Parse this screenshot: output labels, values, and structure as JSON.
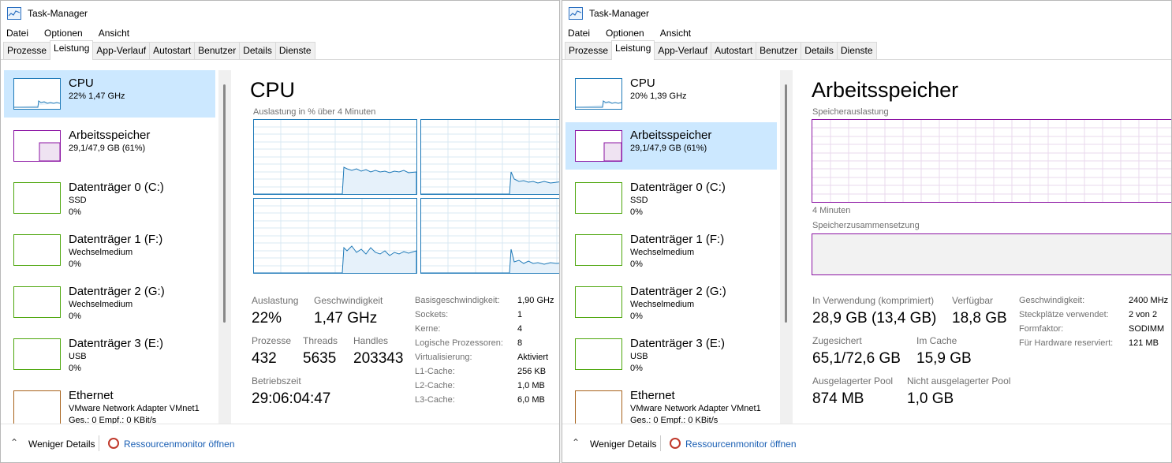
{
  "colors": {
    "cpu": "#1f7ab8",
    "memory": "#8b13a3",
    "disk": "#4da60c",
    "ethernet": "#a7621b",
    "selected": "#cce8ff"
  },
  "left": {
    "title": "Task-Manager",
    "menu": [
      "Datei",
      "Optionen",
      "Ansicht"
    ],
    "tabs": [
      "Prozesse",
      "Leistung",
      "App-Verlauf",
      "Autostart",
      "Benutzer",
      "Details",
      "Dienste"
    ],
    "sidebar": [
      {
        "name": "CPU",
        "line1": "22%  1,47 GHz",
        "line2": ""
      },
      {
        "name": "Arbeitsspeicher",
        "line1": "29,1/47,9 GB (61%)",
        "line2": ""
      },
      {
        "name": "Datenträger 0 (C:)",
        "line1": "SSD",
        "line2": "0%"
      },
      {
        "name": "Datenträger 1 (F:)",
        "line1": "Wechselmedium",
        "line2": "0%"
      },
      {
        "name": "Datenträger 2 (G:)",
        "line1": "Wechselmedium",
        "line2": "0%"
      },
      {
        "name": "Datenträger 3 (E:)",
        "line1": "USB",
        "line2": "0%"
      },
      {
        "name": "Ethernet",
        "line1": "VMware Network Adapter VMnet1",
        "line2": "Ges.: 0 Empf.: 0 KBit/s"
      }
    ],
    "main": {
      "title": "CPU",
      "graph_label": "Auslastung in % über 4 Minuten",
      "stats": {
        "auslastung_label": "Auslastung",
        "auslastung": "22%",
        "geschw_label": "Geschwindigkeit",
        "geschw": "1,47 GHz",
        "prozesse_label": "Prozesse",
        "prozesse": "432",
        "threads_label": "Threads",
        "threads": "5635",
        "handles_label": "Handles",
        "handles": "203343",
        "betrieb_label": "Betriebszeit",
        "betrieb": "29:06:04:47"
      },
      "details": [
        {
          "k": "Basisgeschwindigkeit:",
          "v": "1,90 GHz"
        },
        {
          "k": "Sockets:",
          "v": "1"
        },
        {
          "k": "Kerne:",
          "v": "4"
        },
        {
          "k": "Logische Prozessoren:",
          "v": "8"
        },
        {
          "k": "Virtualisierung:",
          "v": "Aktiviert"
        },
        {
          "k": "L1-Cache:",
          "v": "256 KB"
        },
        {
          "k": "L2-Cache:",
          "v": "1,0 MB"
        },
        {
          "k": "L3-Cache:",
          "v": "6,0 MB"
        }
      ]
    },
    "footer": {
      "less": "Weniger Details",
      "monitor": "Ressourcenmonitor öffnen"
    }
  },
  "right": {
    "title": "Task-Manager",
    "menu": [
      "Datei",
      "Optionen",
      "Ansicht"
    ],
    "tabs": [
      "Prozesse",
      "Leistung",
      "App-Verlauf",
      "Autostart",
      "Benutzer",
      "Details",
      "Dienste"
    ],
    "sidebar": [
      {
        "name": "CPU",
        "line1": "20%  1,39 GHz",
        "line2": ""
      },
      {
        "name": "Arbeitsspeicher",
        "line1": "29,1/47,9 GB (61%)",
        "line2": ""
      },
      {
        "name": "Datenträger 0 (C:)",
        "line1": "SSD",
        "line2": "0%"
      },
      {
        "name": "Datenträger 1 (F:)",
        "line1": "Wechselmedium",
        "line2": "0%"
      },
      {
        "name": "Datenträger 2 (G:)",
        "line1": "Wechselmedium",
        "line2": "0%"
      },
      {
        "name": "Datenträger 3 (E:)",
        "line1": "USB",
        "line2": "0%"
      },
      {
        "name": "Ethernet",
        "line1": "VMware Network Adapter VMnet1",
        "line2": "Ges.: 0 Empf.: 0 KBit/s"
      }
    ],
    "main": {
      "title": "Arbeitsspeicher",
      "usage_label": "Speicherauslastung",
      "time_label": "4 Minuten",
      "comp_label": "Speicherzusammensetzung",
      "stats": {
        "inuse_label": "In Verwendung (komprimiert)",
        "inuse": "28,9 GB (13,4 GB)",
        "avail_label": "Verfügbar",
        "avail": "18,8 GB",
        "commit_label": "Zugesichert",
        "commit": "65,1/72,6 GB",
        "cache_label": "Im Cache",
        "cache": "15,9 GB",
        "paged_label": "Ausgelagerter Pool",
        "paged": "874 MB",
        "nonpaged_label": "Nicht ausgelagerter Pool",
        "nonpaged": "1,0 GB"
      },
      "details": [
        {
          "k": "Geschwindigkeit:",
          "v": "2400 MHz"
        },
        {
          "k": "Steckplätze verwendet:",
          "v": "2 von 2"
        },
        {
          "k": "Formfaktor:",
          "v": "SODIMM"
        },
        {
          "k": "Für Hardware reserviert:",
          "v": "121 MB"
        }
      ]
    },
    "footer": {
      "less": "Weniger Details",
      "monitor": "Ressourcenmonitor öffnen"
    }
  }
}
